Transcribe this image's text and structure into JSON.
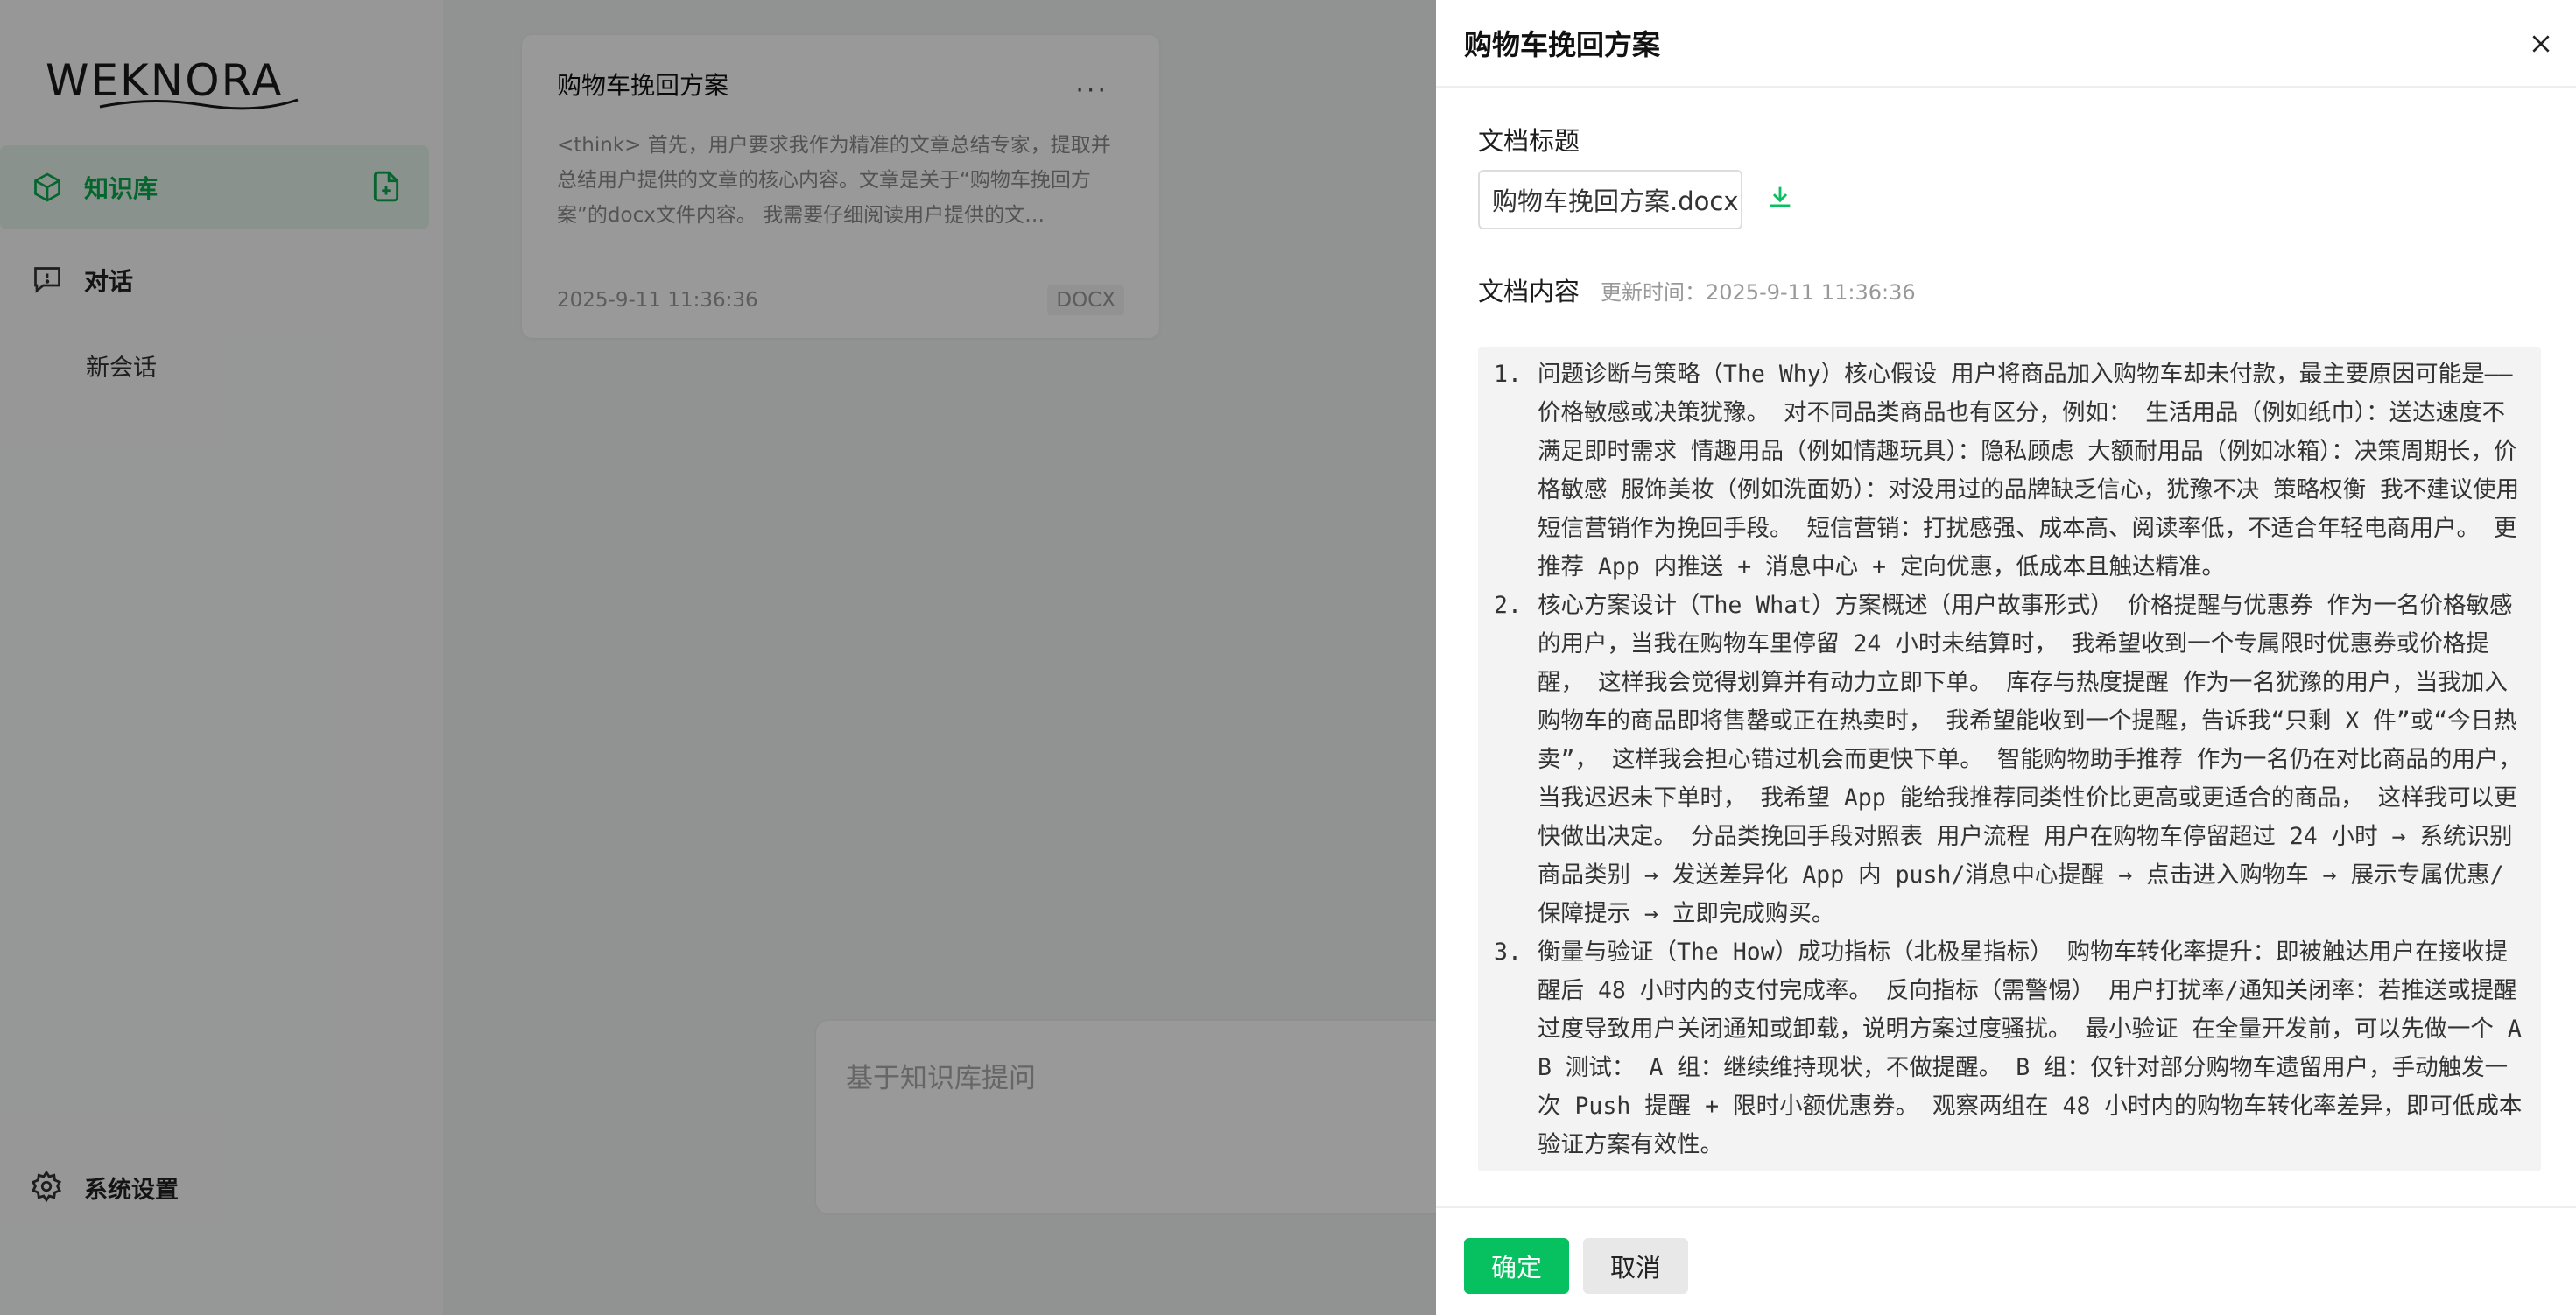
{
  "app": {
    "logo_text": "WEKNORA"
  },
  "sidebar": {
    "items": [
      {
        "label": "知识库",
        "icon": "cube-icon"
      },
      {
        "label": "对话",
        "icon": "chat-icon"
      }
    ],
    "new_chat_label": "新会话",
    "settings_label": "系统设置"
  },
  "main": {
    "card": {
      "title": "购物车挽回方案",
      "more": "···",
      "description": "<think> 首先，用户要求我作为精准的文章总结专家，提取并总结用户提供的文章的核心内容。文章是关于“购物车挽回方案”的docx文件内容。 我需要仔细阅读用户提供的文…",
      "time": "2025-9-11 11:36:36",
      "badge": "DOCX"
    },
    "ask_placeholder": "基于知识库提问"
  },
  "drawer": {
    "title": "购物车挽回方案",
    "doc_title_label": "文档标题",
    "file_name": "购物车挽回方案.docx",
    "doc_content_label": "文档内容",
    "update_time": "更新时间：2025-9-11 11:36:36",
    "content_items": [
      {
        "num": "1.",
        "text": "问题诊断与策略（The Why）核心假设 用户将商品加入购物车却未付款，最主要原因可能是——价格敏感或决策犹豫。 对不同品类商品也有区分，例如： 生活用品（例如纸巾）：送达速度不满足即时需求 情趣用品（例如情趣玩具）：隐私顾虑 大额耐用品（例如冰箱）：决策周期长，价格敏感 服饰美妆（例如洗面奶）：对没用过的品牌缺乏信心，犹豫不决 策略权衡 我不建议使用短信营销作为挽回手段。 短信营销：打扰感强、成本高、阅读率低，不适合年轻电商用户。 更推荐 App 内推送 + 消息中心 + 定向优惠，低成本且触达精准。"
      },
      {
        "num": "2.",
        "text": "核心方案设计（The What）方案概述（用户故事形式） 价格提醒与优惠券 作为一名价格敏感的用户，当我在购物车里停留 24 小时未结算时， 我希望收到一个专属限时优惠券或价格提醒， 这样我会觉得划算并有动力立即下单。 库存与热度提醒 作为一名犹豫的用户，当我加入购物车的商品即将售罄或正在热卖时， 我希望能收到一个提醒，告诉我“只剩 X 件”或“今日热卖”， 这样我会担心错过机会而更快下单。 智能购物助手推荐 作为一名仍在对比商品的用户，当我迟迟未下单时， 我希望 App 能给我推荐同类性价比更高或更适合的商品， 这样我可以更快做出决定。 分品类挽回手段对照表 用户流程 用户在购物车停留超过 24 小时 → 系统识别商品类别 → 发送差异化 App 内 push/消息中心提醒 → 点击进入购物车 → 展示专属优惠/保障提示 → 立即完成购买。"
      },
      {
        "num": "3.",
        "text": "衡量与验证（The How）成功指标（北极星指标） 购物车转化率提升：即被触达用户在接收提醒后 48 小时内的支付完成率。 反向指标（需警惕） 用户打扰率/通知关闭率：若推送或提醒过度导致用户关闭通知或卸载，说明方案过度骚扰。 最小验证 在全量开发前，可以先做一个 AB 测试： A 组：继续维持现状，不做提醒。 B 组：仅针对部分购物车遗留用户，手动触发一次 Push 提醒 + 限时小额优惠券。 观察两组在 48 小时内的购物车转化率差异，即可低成本验证方案有效性。"
      }
    ],
    "ok_label": "确定",
    "cancel_label": "取消"
  },
  "colors": {
    "accent": "#07c160",
    "active_text": "#07a94c",
    "active_bg": "#e7f3ec"
  }
}
